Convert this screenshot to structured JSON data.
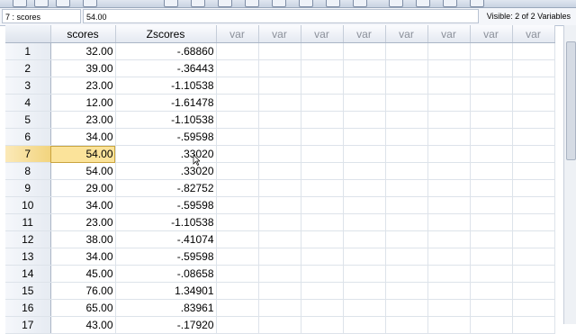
{
  "cell_editor": {
    "reference": "7 : scores",
    "value": "54.00",
    "visible_vars": "Visible: 2 of 2 Variables"
  },
  "columns": [
    "scores",
    "Zscores",
    "var",
    "var",
    "var",
    "var",
    "var",
    "var",
    "var",
    "var"
  ],
  "rows": [
    {
      "n": "1",
      "scores": "32.00",
      "zscores": "-.68860"
    },
    {
      "n": "2",
      "scores": "39.00",
      "zscores": "-.36443"
    },
    {
      "n": "3",
      "scores": "23.00",
      "zscores": "-1.10538"
    },
    {
      "n": "4",
      "scores": "12.00",
      "zscores": "-1.61478"
    },
    {
      "n": "5",
      "scores": "23.00",
      "zscores": "-1.10538"
    },
    {
      "n": "6",
      "scores": "34.00",
      "zscores": "-.59598"
    },
    {
      "n": "7",
      "scores": "54.00",
      "zscores": ".33020"
    },
    {
      "n": "8",
      "scores": "54.00",
      "zscores": ".33020"
    },
    {
      "n": "9",
      "scores": "29.00",
      "zscores": "-.82752"
    },
    {
      "n": "10",
      "scores": "34.00",
      "zscores": "-.59598"
    },
    {
      "n": "11",
      "scores": "23.00",
      "zscores": "-1.10538"
    },
    {
      "n": "12",
      "scores": "38.00",
      "zscores": "-.41074"
    },
    {
      "n": "13",
      "scores": "34.00",
      "zscores": "-.59598"
    },
    {
      "n": "14",
      "scores": "45.00",
      "zscores": "-.08658"
    },
    {
      "n": "15",
      "scores": "76.00",
      "zscores": "1.34901"
    },
    {
      "n": "16",
      "scores": "65.00",
      "zscores": ".83961"
    },
    {
      "n": "17",
      "scores": "43.00",
      "zscores": "-.17920"
    }
  ],
  "selected_row": 7,
  "colors": {
    "selected_cell": "#fbe39a",
    "header_bg": "#e4e9f1"
  }
}
